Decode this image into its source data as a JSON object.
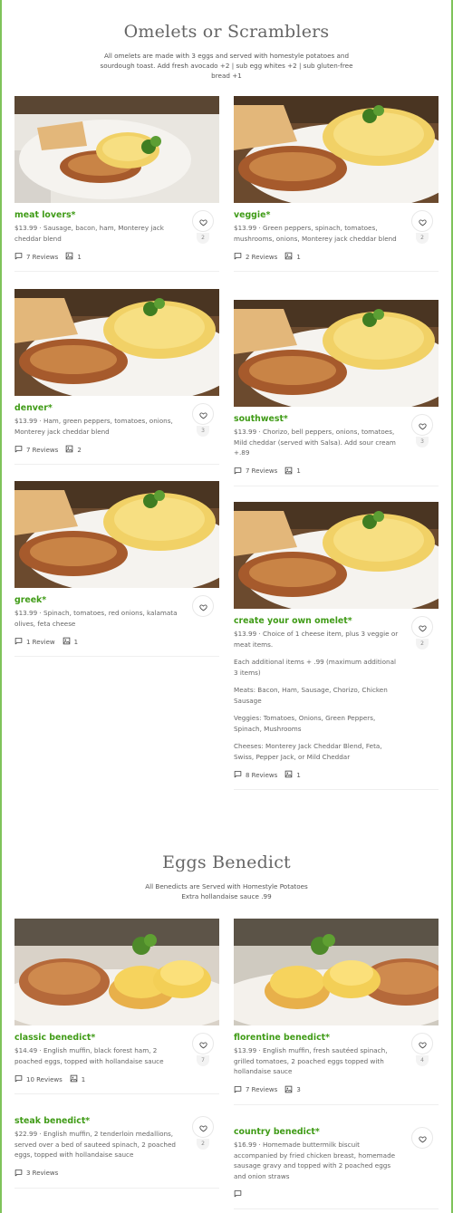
{
  "sections": [
    {
      "title": "Omelets or Scramblers",
      "description": "All omelets are made with 3 eggs and served with homestyle potatoes and sourdough toast. Add fresh avocado +2 | sub egg whites +2 | sub gluten-free bread +1",
      "items": [
        {
          "name": "meat lovers*",
          "desc": [
            "$13.99 · Sausage, bacon, ham, Monterey jack cheddar blend"
          ],
          "favorites": "2",
          "reviews": "7 Reviews",
          "photos": "1"
        },
        {
          "name": "veggie*",
          "desc": [
            "$13.99 · Green peppers, spinach, tomatoes, mushrooms, onions, Monterey jack cheddar blend"
          ],
          "favorites": "2",
          "reviews": "2 Reviews",
          "photos": "1"
        },
        {
          "name": "denver*",
          "desc": [
            "$13.99 · Ham, green peppers, tomatoes, onions, Monterey jack cheddar blend"
          ],
          "favorites": "3",
          "reviews": "7 Reviews",
          "photos": "2"
        },
        {
          "name": "southwest*",
          "desc": [
            "$13.99 · Chorizo, bell peppers, onions, tomatoes, Mild cheddar (served with Salsa). Add sour cream +.89"
          ],
          "favorites": "3",
          "reviews": "7 Reviews",
          "photos": "1"
        },
        {
          "name": "greek*",
          "desc": [
            "$13.99 · Spinach, tomatoes, red onions, kalamata olives, feta cheese"
          ],
          "favorites": "",
          "reviews": "1 Review",
          "photos": "1"
        },
        {
          "name": "create your own omelet*",
          "desc": [
            "$13.99 · Choice of 1 cheese item, plus 3 veggie or meat items.",
            "Each additional items + .99 (maximum additional 3 items)",
            "Meats: Bacon, Ham, Sausage, Chorizo, Chicken Sausage",
            "Veggies: Tomatoes, Onions, Green Peppers, Spinach, Mushrooms",
            "Cheeses: Monterey Jack Cheddar Blend, Feta, Swiss, Pepper Jack, or Mild Cheddar"
          ],
          "favorites": "2",
          "reviews": "8 Reviews",
          "photos": "1"
        }
      ]
    },
    {
      "title": "Eggs Benedict",
      "description": "All Benedicts are Served with Homestyle Potatoes Extra hollandaise sauce .99",
      "items": [
        {
          "name": "classic benedict*",
          "desc": [
            "$14.49 · English muffin, black forest ham, 2 poached eggs, topped with hollandaise sauce"
          ],
          "favorites": "7",
          "reviews": "10 Reviews",
          "photos": "1"
        },
        {
          "name": "florentine benedict*",
          "desc": [
            "$13.99 · English muffin, fresh sautéed spinach, grilled tomatoes, 2 poached eggs topped with hollandaise sauce"
          ],
          "favorites": "4",
          "reviews": "7 Reviews",
          "photos": "3"
        },
        {
          "name": "steak benedict*",
          "desc": [
            "$22.99 · English muffin, 2 tenderloin medallions, served over a bed of sauteed spinach, 2 poached eggs, topped with hollandaise sauce"
          ],
          "favorites": "2",
          "reviews": "3 Reviews",
          "photos": ""
        },
        {
          "name": "country benedict*",
          "desc": [
            "$16.99 · Homemade buttermilk biscuit accompanied by fried chicken breast, homemade sausage gravy and topped with 2 poached eggs and onion straws"
          ],
          "favorites": "",
          "reviews": "",
          "photos": ""
        }
      ]
    }
  ],
  "icons": {
    "favorite": "heart-icon",
    "reviews": "comment-icon",
    "photos": "image-icon"
  },
  "colors": {
    "accent": "#3f9b16",
    "border": "#7fc35a"
  }
}
